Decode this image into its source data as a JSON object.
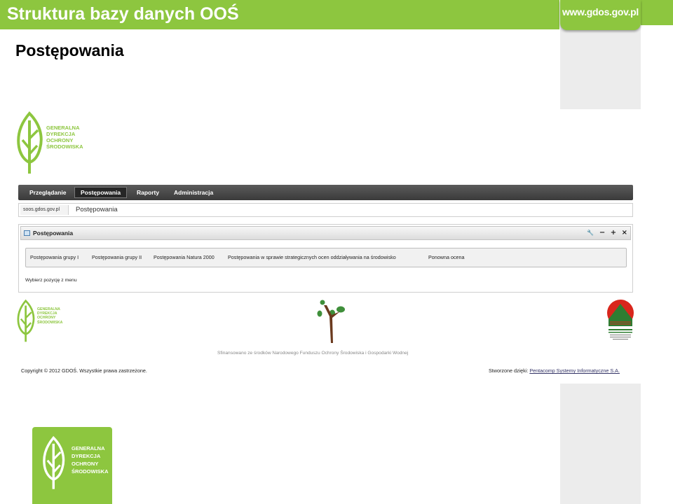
{
  "slide": {
    "title": "Struktura bazy danych OOŚ",
    "url_badge": "www.gdos.gov.pl",
    "heading": "Postępowania"
  },
  "logo": {
    "line1": "GENERALNA",
    "line2": "DYREKCJA",
    "line3": "OCHRONY",
    "line4": "ŚRODOWISKA"
  },
  "nav": {
    "items": [
      {
        "label": "Przeglądanie"
      },
      {
        "label": "Postępowania"
      },
      {
        "label": "Raporty"
      },
      {
        "label": "Administracja"
      }
    ],
    "active": "Postępowania"
  },
  "breadcrumb": {
    "home": "soos.gdos.gov.pl",
    "current": "Postępowania"
  },
  "portlet": {
    "title": "Postępowania",
    "controls": {
      "settings": "🔧",
      "minimize": "−",
      "maximize": "+",
      "close": "×"
    },
    "menu_items": [
      {
        "label": "Postępowania grupy I"
      },
      {
        "label": "Postępowania grupy II"
      },
      {
        "label": "Postępowania Natura 2000"
      },
      {
        "label": "Postępowania w sprawie strategicznych ocen oddziaływania na środowisko"
      },
      {
        "label": "Ponowna ocena"
      }
    ],
    "hint": "Wybierz pozycję z menu"
  },
  "footer": {
    "funding": "Sfinansowano ze środków Narodowego Funduszu Ochrony Środowiska i Gospodarki Wodnej",
    "copyright": "Copyright © 2012 GDOŚ. Wszystkie prawa zastrzeżone.",
    "credits_prefix": "Stworzone dzięki: ",
    "credits_link": "Pentacomp Systemy Informatyczne S.A."
  },
  "colors": {
    "brand_green": "#8dc63f",
    "nav_dark": "#3a3a3a",
    "nfos_red": "#d9261c",
    "nfos_green": "#2e7d32",
    "tree_brown": "#6b3a1e"
  }
}
